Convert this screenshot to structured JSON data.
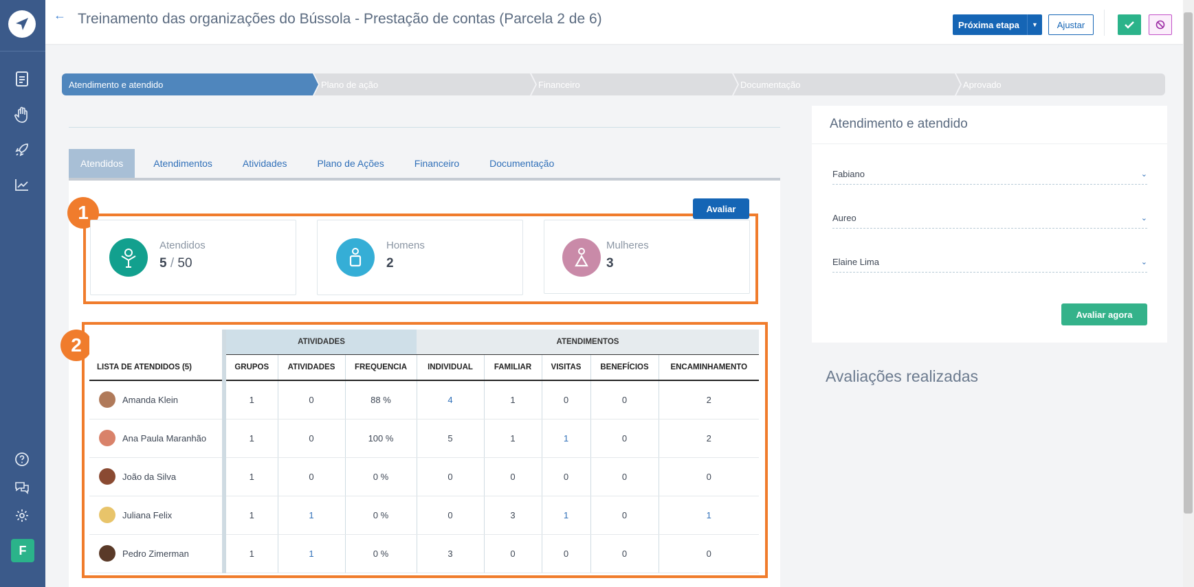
{
  "header": {
    "title": "Treinamento das organizações do Bússola - Prestação de contas (Parcela 2 de 6)",
    "next_step_label": "Próxima etapa",
    "adjust_label": "Ajustar"
  },
  "sidebar": {
    "avatar_letter": "F",
    "items": [
      "document-icon",
      "hand-icon",
      "rocket-icon",
      "chart-icon"
    ],
    "bottom_items": [
      "help-icon",
      "chat-icon",
      "gear-icon"
    ]
  },
  "stepper": [
    {
      "label": "Atendimento e atendido",
      "active": true
    },
    {
      "label": "Plano de ação",
      "active": false
    },
    {
      "label": "Financeiro",
      "active": false
    },
    {
      "label": "Documentação",
      "active": false
    },
    {
      "label": "Aprovado",
      "active": false
    }
  ],
  "tabs": [
    {
      "label": "Atendidos",
      "active": true
    },
    {
      "label": "Atendimentos",
      "active": false
    },
    {
      "label": "Atividades",
      "active": false
    },
    {
      "label": "Plano de Ações",
      "active": false
    },
    {
      "label": "Financeiro",
      "active": false
    },
    {
      "label": "Documentação",
      "active": false
    }
  ],
  "avaliar_label": "Avaliar",
  "highlights": {
    "one": "1",
    "two": "2"
  },
  "stats": {
    "atendidos": {
      "label": "Atendidos",
      "value": "5",
      "total": "50",
      "color": "#12a08e"
    },
    "homens": {
      "label": "Homens",
      "value": "2",
      "color": "#35aed6"
    },
    "mulheres": {
      "label": "Mulheres",
      "value": "3",
      "color": "#c98aa8"
    }
  },
  "table": {
    "group_atividades": "ATIVIDADES",
    "group_atendimentos": "ATENDIMENTOS",
    "columns": [
      "LISTA DE ATENDIDOS (5)",
      "GRUPOS",
      "ATIVIDADES",
      "FREQUENCIA",
      "INDIVIDUAL",
      "FAMILIAR",
      "VISITAS",
      "BENEFÍCIOS",
      "ENCAMINHAMENTO"
    ],
    "rows": [
      {
        "name": "Amanda Klein",
        "grupos": "1",
        "atividades": "0",
        "frequencia": "88 %",
        "individual": "4",
        "familiar": "1",
        "visitas": "0",
        "beneficios": "0",
        "encaminhamento": "2",
        "avatar_color": "#b07a5a"
      },
      {
        "name": "Ana Paula Maranhão",
        "grupos": "1",
        "atividades": "0",
        "frequencia": "100 %",
        "individual": "5",
        "familiar": "1",
        "visitas": "1",
        "beneficios": "0",
        "encaminhamento": "2",
        "avatar_color": "#d9826a"
      },
      {
        "name": "João da Silva",
        "grupos": "1",
        "atividades": "0",
        "frequencia": "0 %",
        "individual": "0",
        "familiar": "0",
        "visitas": "0",
        "beneficios": "0",
        "encaminhamento": "0",
        "avatar_color": "#8a4a32"
      },
      {
        "name": "Juliana Felix",
        "grupos": "1",
        "atividades": "1",
        "frequencia": "0 %",
        "individual": "0",
        "familiar": "3",
        "visitas": "1",
        "beneficios": "0",
        "encaminhamento": "1",
        "avatar_color": "#e8c46a"
      },
      {
        "name": "Pedro Zimerman",
        "grupos": "1",
        "atividades": "1",
        "frequencia": "0 %",
        "individual": "3",
        "familiar": "0",
        "visitas": "0",
        "beneficios": "0",
        "encaminhamento": "0",
        "avatar_color": "#5a3a28"
      }
    ]
  },
  "right_panel": {
    "title": "Atendimento e atendido",
    "selects": [
      "Fabiano",
      "Aureo",
      "Elaine Lima"
    ],
    "button_label": "Avaliar agora",
    "evaluations_title": "Avaliações realizadas"
  }
}
